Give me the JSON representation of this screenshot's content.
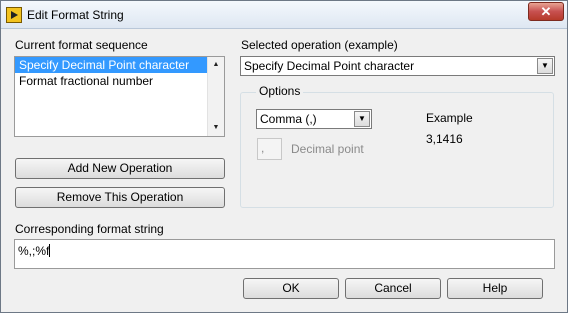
{
  "window": {
    "title": "Edit Format String",
    "close_label": "✕"
  },
  "sequence": {
    "label": "Current format sequence",
    "items": [
      {
        "label": "Specify Decimal Point character",
        "selected": true
      },
      {
        "label": "Format fractional number",
        "selected": false
      }
    ],
    "add_button": "Add New Operation",
    "remove_button": "Remove This Operation"
  },
  "operation": {
    "label": "Selected operation (example)",
    "selected": "Specify Decimal Point character"
  },
  "options": {
    "group_title": "Options",
    "separator_selected": "Comma (,)",
    "decimal_char_value": ",",
    "decimal_point_label": "Decimal point"
  },
  "example": {
    "label": "Example",
    "value": "3,1416"
  },
  "format_string": {
    "label": "Corresponding format string",
    "value": "%,;%f"
  },
  "buttons": {
    "ok": "OK",
    "cancel": "Cancel",
    "help": "Help"
  },
  "icons": {
    "app": "labview-icon",
    "scroll_up": "▲",
    "scroll_down": "▼",
    "dropdown": "▼"
  },
  "colors": {
    "selection": "#3399ff",
    "close_button": "#c75050"
  }
}
